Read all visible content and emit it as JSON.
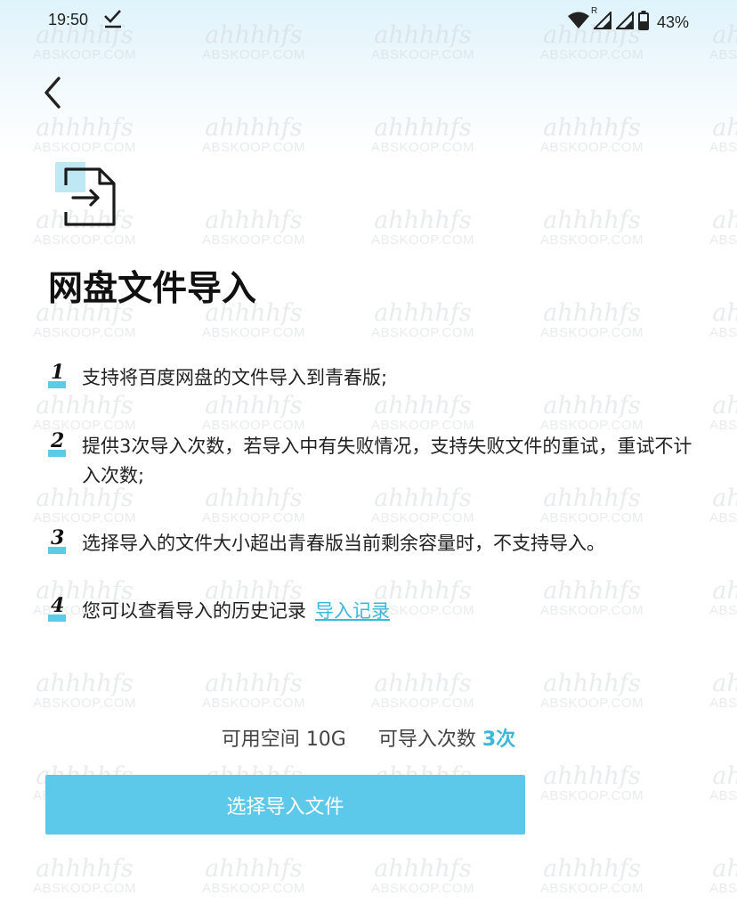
{
  "status_bar": {
    "time": "19:50",
    "battery_percent": "43%",
    "roaming_mark": "R",
    "icons": [
      "check-icon",
      "wifi-icon",
      "signal-icon",
      "signal-icon",
      "battery-icon"
    ]
  },
  "header": {
    "back_icon": "chevron-left-icon",
    "feature_icon": "file-import-icon",
    "title": "网盘文件导入"
  },
  "rules": [
    {
      "num": "1",
      "text": "支持将百度网盘的文件导入到青春版;"
    },
    {
      "num": "2",
      "text": "提供3次导入次数，若导入中有失败情况，支持失败文件的重试，重试不计入次数;"
    },
    {
      "num": "3",
      "text": "选择导入的文件大小超出青春版当前剩余容量时，不支持导入。"
    },
    {
      "num": "4",
      "text": "您可以查看导入的历史记录",
      "link": "导入记录"
    }
  ],
  "quota": {
    "space_label": "可用空间",
    "space_value": "10G",
    "count_label": "可导入次数",
    "count_value": "3次"
  },
  "action_button": "选择导入文件",
  "watermark": {
    "line1": "ahhhhfs",
    "line2": "ABSKOOP.COM"
  },
  "colors": {
    "accent": "#5dc9ea",
    "link": "#3bb8d9",
    "header_gradient": "#dff3fb",
    "title": "#111111"
  }
}
